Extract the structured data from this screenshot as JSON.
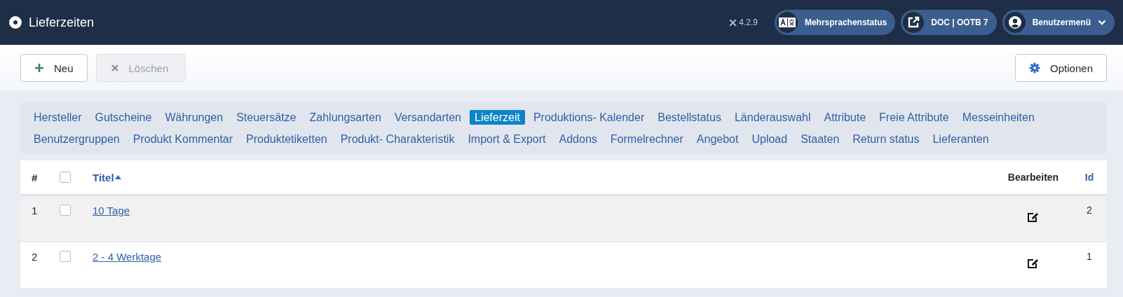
{
  "header": {
    "title": "Lieferzeiten",
    "version": "4.2.9",
    "buttons": [
      {
        "kind": "language",
        "label": "Mehrsprachenstatus"
      },
      {
        "kind": "external",
        "label": "DOC | OOTB 7"
      },
      {
        "kind": "user",
        "label": "Benutzermenü"
      }
    ]
  },
  "toolbar": {
    "buttons": [
      {
        "kind": "new",
        "label": "Neu",
        "disabled": false
      },
      {
        "kind": "delete",
        "label": "Löschen",
        "disabled": true
      }
    ],
    "options": {
      "label": "Optionen"
    }
  },
  "nav": [
    {
      "label": "Hersteller",
      "selected": false
    },
    {
      "label": "Gutscheine",
      "selected": false
    },
    {
      "label": "Währungen",
      "selected": false
    },
    {
      "label": "Steuersätze",
      "selected": false
    },
    {
      "label": "Zahlungsarten",
      "selected": false
    },
    {
      "label": "Versandarten",
      "selected": false
    },
    {
      "label": "Lieferzeit",
      "selected": true
    },
    {
      "label": "Produktions- Kalender",
      "selected": false
    },
    {
      "label": "Bestellstatus",
      "selected": false
    },
    {
      "label": "Länderauswahl",
      "selected": false
    },
    {
      "label": "Attribute",
      "selected": false
    },
    {
      "label": "Freie Attribute",
      "selected": false
    },
    {
      "label": "Messeinheiten",
      "selected": false
    },
    {
      "label": "Benutzergruppen",
      "selected": false
    },
    {
      "label": "Produkt Kommentar",
      "selected": false
    },
    {
      "label": "Produktetiketten",
      "selected": false
    },
    {
      "label": "Produkt- Charakteristik",
      "selected": false
    },
    {
      "label": "Import & Export",
      "selected": false
    },
    {
      "label": "Addons",
      "selected": false
    },
    {
      "label": "Formelrechner",
      "selected": false
    },
    {
      "label": "Angebot",
      "selected": false
    },
    {
      "label": "Upload",
      "selected": false
    },
    {
      "label": "Staaten",
      "selected": false
    },
    {
      "label": "Return status",
      "selected": false
    },
    {
      "label": "Lieferanten",
      "selected": false
    }
  ],
  "table": {
    "columns": {
      "number": "#",
      "title": "Titel",
      "edit": "Bearbeiten",
      "id": "Id"
    },
    "all_checked": false,
    "rows": [
      {
        "number": "1",
        "checked": false,
        "title": "10 Tage",
        "id": "2"
      },
      {
        "number": "2",
        "checked": false,
        "title": "2 - 4 Werktage",
        "id": "1"
      }
    ]
  }
}
